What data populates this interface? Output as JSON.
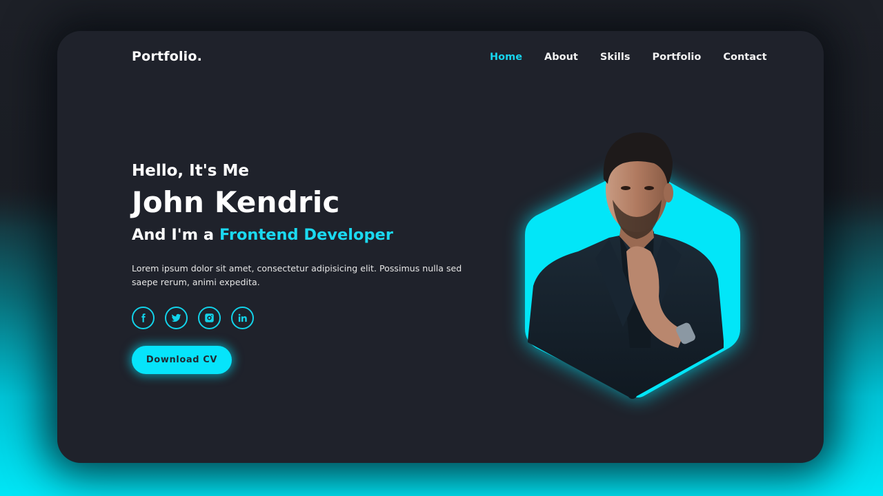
{
  "brand": {
    "logo": "Portfolio.",
    "accent_color": "#1bd9f0",
    "card_color": "#1f222b"
  },
  "nav": {
    "items": [
      {
        "label": "Home",
        "active": true
      },
      {
        "label": "About",
        "active": false
      },
      {
        "label": "Skills",
        "active": false
      },
      {
        "label": "Portfolio",
        "active": false
      },
      {
        "label": "Contact",
        "active": false
      }
    ]
  },
  "hero": {
    "greeting": "Hello, It's Me",
    "name": "John Kendric",
    "role_prefix": "And I'm a ",
    "role_highlight": "Frontend Developer",
    "description": "Lorem ipsum dolor sit amet, consectetur adipisicing elit. Possimus nulla sed saepe rerum, animi expedita.",
    "socials": [
      {
        "icon": "facebook-icon",
        "label": "Facebook"
      },
      {
        "icon": "twitter-icon",
        "label": "Twitter"
      },
      {
        "icon": "instagram-icon",
        "label": "Instagram"
      },
      {
        "icon": "linkedin-icon",
        "label": "LinkedIn"
      }
    ],
    "cta_label": "Download CV"
  },
  "portrait": {
    "alt": "Portrait of a man in a dark suit with hand on chin, framed by a cyan hexagon"
  }
}
